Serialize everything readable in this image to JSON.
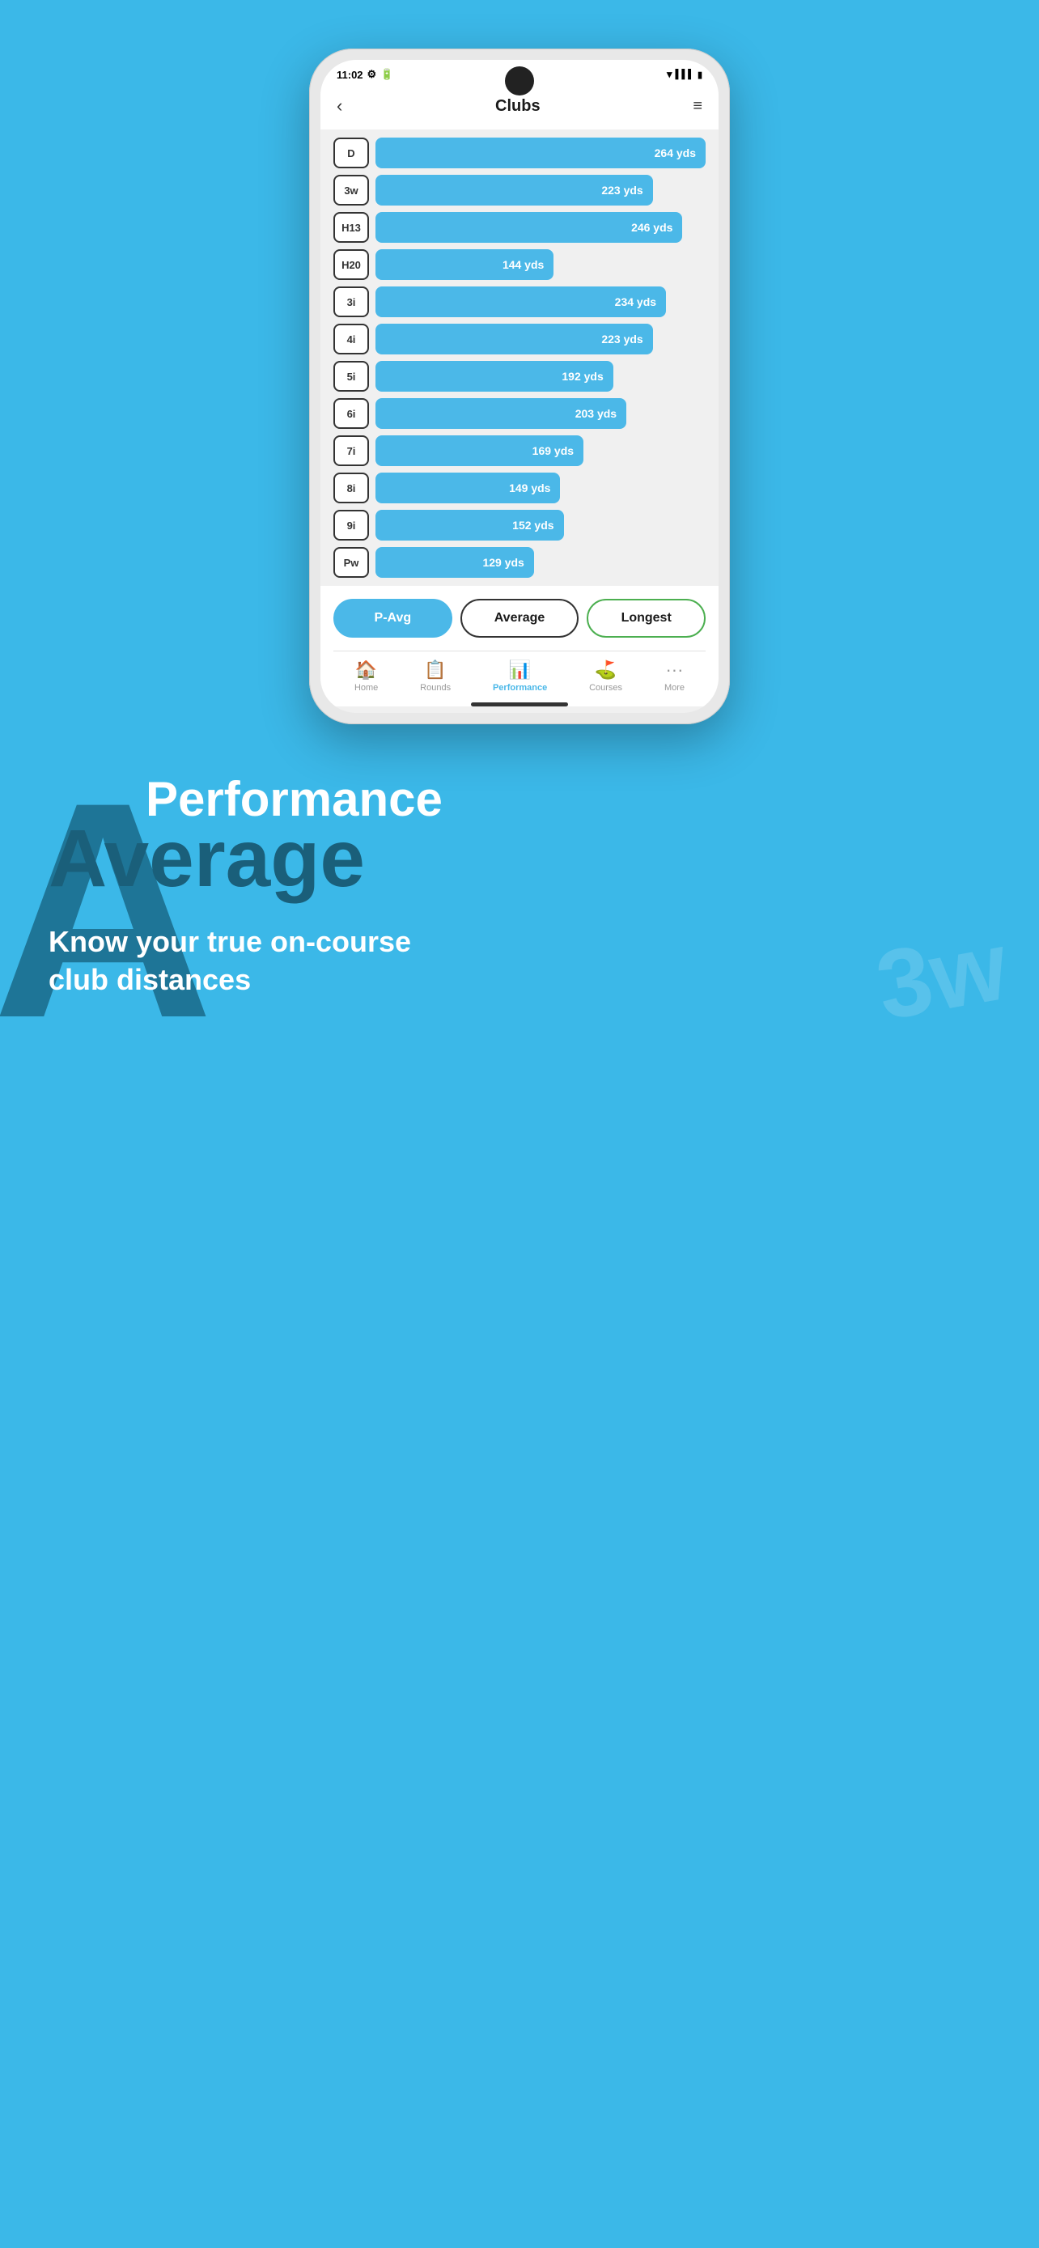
{
  "statusBar": {
    "time": "11:02",
    "icons": [
      "gear",
      "battery-saver",
      "wifi",
      "signal",
      "battery"
    ]
  },
  "header": {
    "title": "Clubs",
    "backLabel": "‹",
    "filterIcon": "≡"
  },
  "clubs": [
    {
      "label": "D",
      "yards": "264 yds",
      "pct": 100
    },
    {
      "label": "3w",
      "yards": "223 yds",
      "pct": 84
    },
    {
      "label": "H13",
      "yards": "246 yds",
      "pct": 93
    },
    {
      "label": "H20",
      "yards": "144 yds",
      "pct": 54
    },
    {
      "label": "3i",
      "yards": "234 yds",
      "pct": 88
    },
    {
      "label": "4i",
      "yards": "223 yds",
      "pct": 84
    },
    {
      "label": "5i",
      "yards": "192 yds",
      "pct": 72
    },
    {
      "label": "6i",
      "yards": "203 yds",
      "pct": 76
    },
    {
      "label": "7i",
      "yards": "169 yds",
      "pct": 63
    },
    {
      "label": "8i",
      "yards": "149 yds",
      "pct": 56
    },
    {
      "label": "9i",
      "yards": "152 yds",
      "pct": 57
    },
    {
      "label": "Pw",
      "yards": "129 yds",
      "pct": 48
    }
  ],
  "filterButtons": [
    {
      "id": "pavg",
      "label": "P-Avg",
      "style": "active-blue"
    },
    {
      "id": "average",
      "label": "Average",
      "style": "outline-dark"
    },
    {
      "id": "longest",
      "label": "Longest",
      "style": "outline-green"
    }
  ],
  "bottomNav": [
    {
      "id": "home",
      "icon": "🏠",
      "label": "Home",
      "active": false
    },
    {
      "id": "rounds",
      "icon": "📋",
      "label": "Rounds",
      "active": false
    },
    {
      "id": "performance",
      "icon": "📊",
      "label": "Performance",
      "active": true
    },
    {
      "id": "courses",
      "icon": "⛳",
      "label": "Courses",
      "active": false
    },
    {
      "id": "more",
      "icon": "···",
      "label": "More",
      "active": false
    }
  ],
  "marketing": {
    "letterA": "A",
    "line1": "Performance",
    "line2": "Average",
    "subtitle": "Know your true on-course club distances",
    "watermark": "3w"
  }
}
